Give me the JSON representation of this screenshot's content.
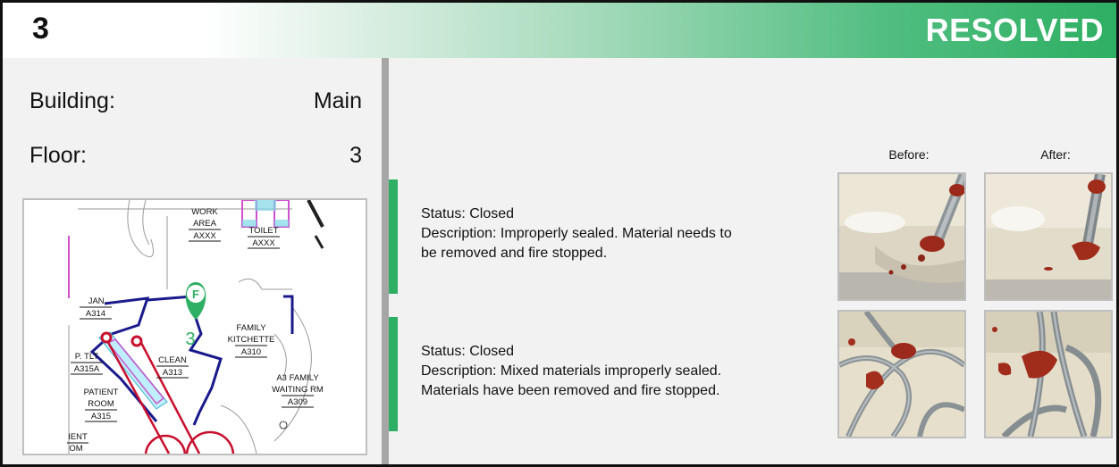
{
  "header": {
    "number": "3",
    "status": "RESOLVED"
  },
  "location": {
    "building_label": "Building:",
    "building_value": "Main",
    "floor_label": "Floor:",
    "floor_value": "3"
  },
  "map": {
    "marker_letter": "F",
    "marker_number": "3",
    "rooms": [
      {
        "name": "WORK",
        "name2": "AREA",
        "code": "AXXX"
      },
      {
        "name": "TOILET",
        "code": "AXXX"
      },
      {
        "name": "JAN.",
        "code": "A314"
      },
      {
        "name": "FAMILY",
        "name2": "KITCHETTE",
        "code": "A310"
      },
      {
        "name": "CLEAN",
        "code": "A313"
      },
      {
        "name": "P. TLT",
        "code": "A315A"
      },
      {
        "name": "PATIENT",
        "name2": "ROOM",
        "code": "A315"
      },
      {
        "name": "A3 FAMILY",
        "name2": "WAITING RM",
        "code": "A309"
      },
      {
        "name": "IENT",
        "name2": "OM"
      }
    ]
  },
  "photos": {
    "before_label": "Before:",
    "after_label": "After:"
  },
  "issues": [
    {
      "status": "Status: Closed",
      "description_line1": "Description: Improperly sealed. Material needs to",
      "description_line2": "be removed and fire stopped."
    },
    {
      "status": "Status: Closed",
      "description_line1": "Description: Mixed materials improperly sealed.",
      "description_line2": "Materials have been removed and fire stopped."
    }
  ],
  "colors": {
    "accent_green": "#2eaf63",
    "divider_gray": "#a6a6a6",
    "panel_bg": "#f2f2f2",
    "map_wall_blue": "#1a1a8c",
    "map_red": "#c8102e"
  }
}
